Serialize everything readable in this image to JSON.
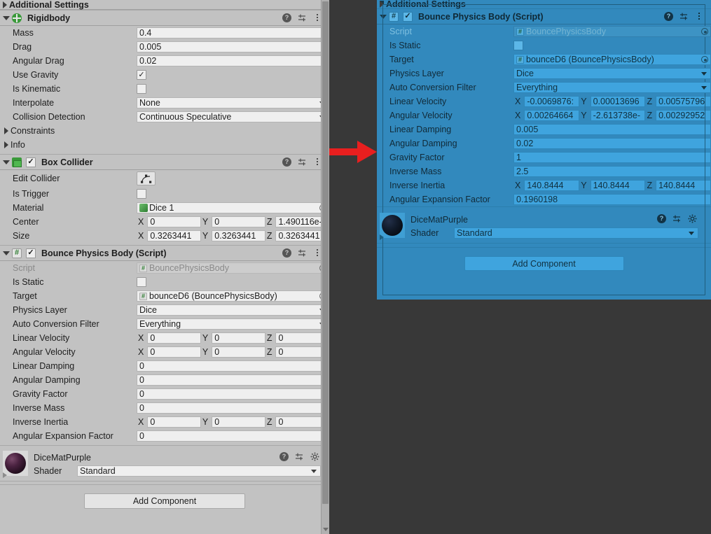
{
  "meta": {
    "app": "Unity Inspector",
    "colors": {
      "panel_bg": "#c2c2c2",
      "selected_panel_bg": "#3289bd",
      "field_bg": "#efefef",
      "selected_field_bg": "#3fa4de",
      "backdrop": "#383838",
      "annotation_arrow": "#e81f1f",
      "component_icon_green": "#3a9a3a"
    }
  },
  "annotation": {
    "arrow_name": "red-right-arrow",
    "direction": "right"
  },
  "cut_off_header": {
    "label": "Additional Settings"
  },
  "left_panel": {
    "rigidbody": {
      "title": "Rigidbody",
      "icon": "rigidbody-icon",
      "rows": [
        {
          "label": "Mass",
          "type": "text",
          "value": "0.4"
        },
        {
          "label": "Drag",
          "type": "text",
          "value": "0.005"
        },
        {
          "label": "Angular Drag",
          "type": "text",
          "value": "0.02"
        },
        {
          "label": "Use Gravity",
          "type": "checkbox",
          "checked": true
        },
        {
          "label": "Is Kinematic",
          "type": "checkbox",
          "checked": false
        },
        {
          "label": "Interpolate",
          "type": "dropdown",
          "value": "None"
        },
        {
          "label": "Collision Detection",
          "type": "dropdown",
          "value": "Continuous Speculative"
        }
      ],
      "foldouts": [
        {
          "label": "Constraints"
        },
        {
          "label": "Info"
        }
      ]
    },
    "box_collider": {
      "title": "Box Collider",
      "icon": "box-collider-icon",
      "enabled": true,
      "edit_collider_label": "Edit Collider",
      "rows": [
        {
          "label": "Is Trigger",
          "type": "checkbox",
          "checked": false
        },
        {
          "label": "Material",
          "type": "object",
          "value": "Dice 1"
        },
        {
          "label": "Center",
          "type": "vector3",
          "x": "0",
          "y": "0",
          "z": "1.490116e-"
        },
        {
          "label": "Size",
          "type": "vector3",
          "x": "0.3263441",
          "y": "0.3263441",
          "z": "0.3263441"
        }
      ]
    },
    "bounce_physics_body": {
      "title": "Bounce Physics Body (Script)",
      "icon": "script-icon",
      "enabled": true,
      "rows": [
        {
          "label": "Script",
          "type": "object_readonly",
          "value": "BouncePhysicsBody"
        },
        {
          "label": "Is Static",
          "type": "checkbox",
          "checked": false
        },
        {
          "label": "Target",
          "type": "object",
          "value": "bounceD6 (BouncePhysicsBody)"
        },
        {
          "label": "Physics Layer",
          "type": "dropdown",
          "value": "Dice"
        },
        {
          "label": "Auto Conversion Filter",
          "type": "dropdown",
          "value": "Everything"
        },
        {
          "label": "Linear Velocity",
          "type": "vector3",
          "x": "0",
          "y": "0",
          "z": "0"
        },
        {
          "label": "Angular Velocity",
          "type": "vector3",
          "x": "0",
          "y": "0",
          "z": "0"
        },
        {
          "label": "Linear Damping",
          "type": "text",
          "value": "0"
        },
        {
          "label": "Angular Damping",
          "type": "text",
          "value": "0"
        },
        {
          "label": "Gravity Factor",
          "type": "text",
          "value": "0"
        },
        {
          "label": "Inverse Mass",
          "type": "text",
          "value": "0"
        },
        {
          "label": "Inverse Inertia",
          "type": "vector3",
          "x": "0",
          "y": "0",
          "z": "0"
        },
        {
          "label": "Angular Expansion Factor",
          "type": "text",
          "value": "0"
        }
      ]
    },
    "material": {
      "name": "DiceMatPurple",
      "shader_label": "Shader",
      "shader_value": "Standard",
      "preview_color": "#3b1b33"
    },
    "add_component_label": "Add Component"
  },
  "right_panel": {
    "bounce_physics_body": {
      "title": "Bounce Physics Body (Script)",
      "icon": "script-icon",
      "enabled": true,
      "rows": [
        {
          "label": "Script",
          "type": "object_readonly",
          "value": "BouncePhysicsBody"
        },
        {
          "label": "Is Static",
          "type": "checkbox",
          "checked": false
        },
        {
          "label": "Target",
          "type": "object",
          "value": "bounceD6 (BouncePhysicsBody)"
        },
        {
          "label": "Physics Layer",
          "type": "dropdown",
          "value": "Dice"
        },
        {
          "label": "Auto Conversion Filter",
          "type": "dropdown",
          "value": "Everything"
        },
        {
          "label": "Linear Velocity",
          "type": "vector3",
          "x": "-0.0069876:",
          "y": "0.00013696",
          "z": "0.00575796"
        },
        {
          "label": "Angular Velocity",
          "type": "vector3",
          "x": "0.00264664",
          "y": "-2.613738e-",
          "z": "0.00292952"
        },
        {
          "label": "Linear Damping",
          "type": "text",
          "value": "0.005"
        },
        {
          "label": "Angular Damping",
          "type": "text",
          "value": "0.02"
        },
        {
          "label": "Gravity Factor",
          "type": "text",
          "value": "1"
        },
        {
          "label": "Inverse Mass",
          "type": "text",
          "value": "2.5"
        },
        {
          "label": "Inverse Inertia",
          "type": "vector3",
          "x": "140.8444",
          "y": "140.8444",
          "z": "140.8444"
        },
        {
          "label": "Angular Expansion Factor",
          "type": "text",
          "value": "0.1960198"
        }
      ]
    },
    "material": {
      "name": "DiceMatPurple",
      "shader_label": "Shader",
      "shader_value": "Standard"
    },
    "add_component_label": "Add Component"
  },
  "icons": {
    "help": "?",
    "preset": "preset-icon",
    "menu": "kebab-menu-icon",
    "gear": "gear-icon",
    "checkmark": "✓"
  }
}
